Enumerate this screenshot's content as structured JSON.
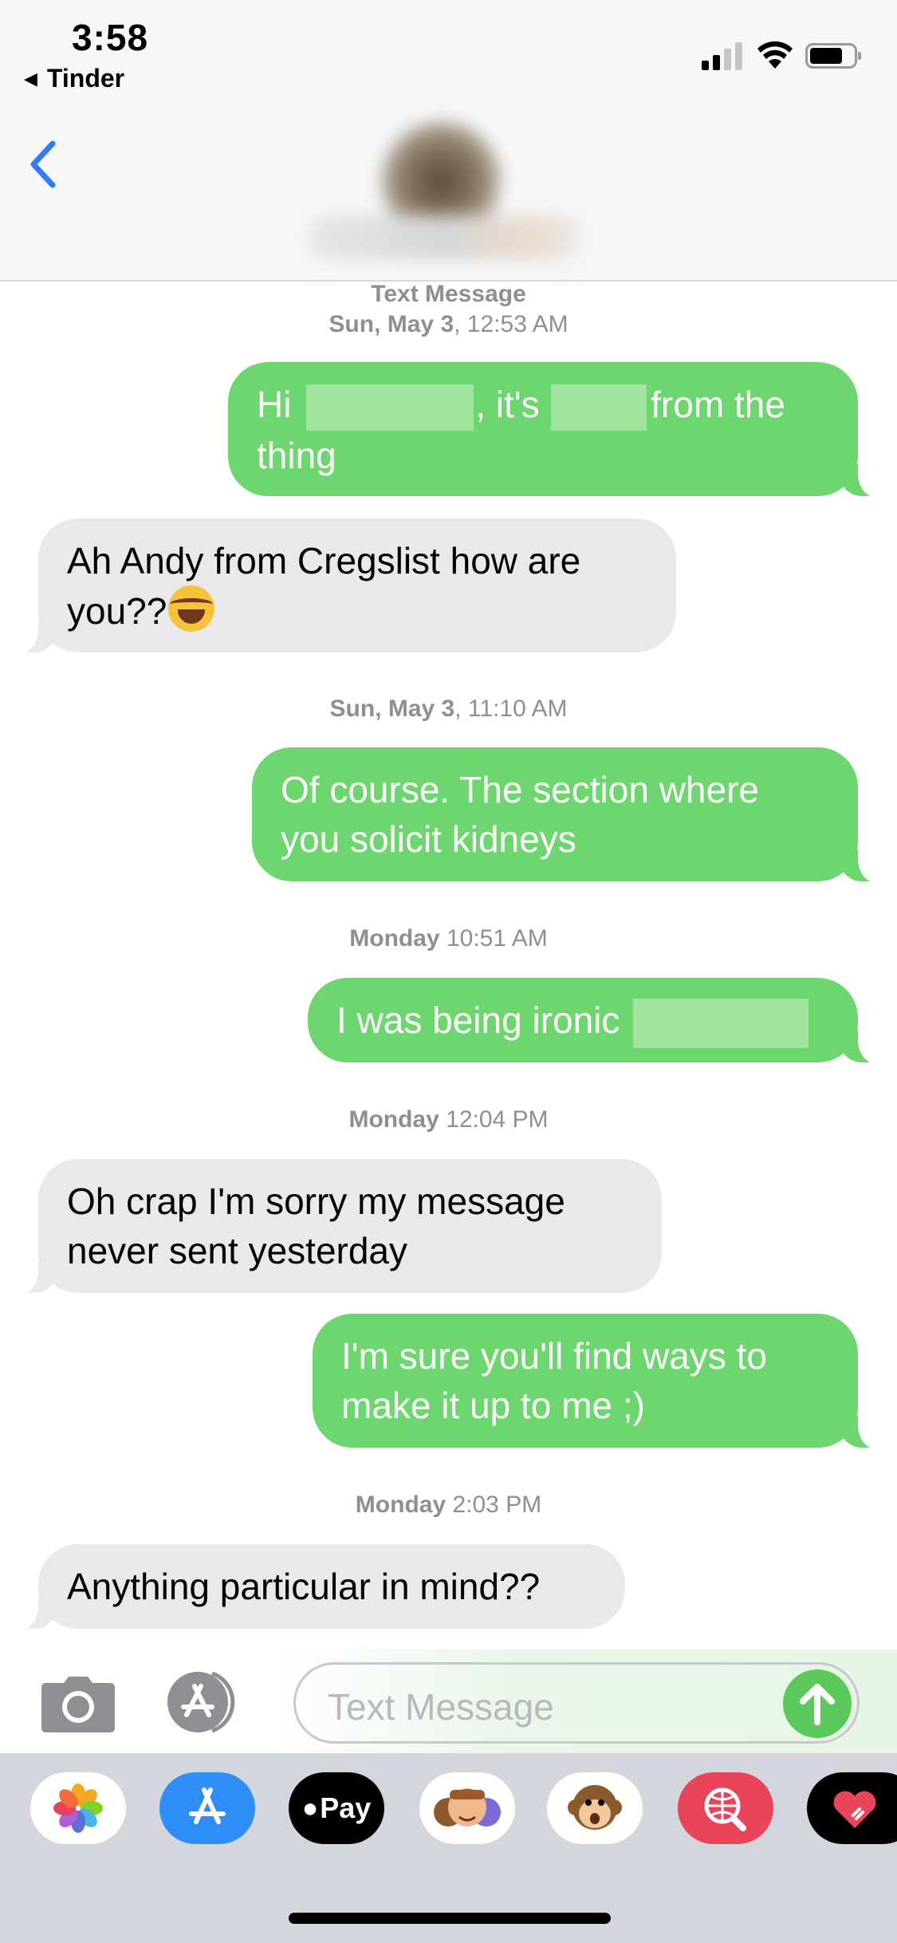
{
  "status_bar": {
    "time": "3:58",
    "back_app": "Tinder"
  },
  "header": {
    "contact": ""
  },
  "messages": [
    {
      "type": "stamp",
      "label": "Text Message",
      "day": "Sun, May 3",
      "time": ", 12:53 AM"
    },
    {
      "type": "sent",
      "parts": [
        "Hi",
        ", it's",
        " from the",
        "thing"
      ]
    },
    {
      "type": "received",
      "text_line1": "Ah Andy from Cregslist how are",
      "text_line2": "you??"
    },
    {
      "type": "stamp",
      "day": "Sun, May 3",
      "time": ", 11:10 AM"
    },
    {
      "type": "sent",
      "line1": "Of course. The section where",
      "line2": "you solicit kidneys"
    },
    {
      "type": "stamp",
      "day": "Monday",
      "time": " 10:51 AM"
    },
    {
      "type": "sent",
      "text": "I was being ironic"
    },
    {
      "type": "stamp",
      "day": "Monday",
      "time": " 12:04 PM"
    },
    {
      "type": "received",
      "line1": "Oh crap I'm sorry my message",
      "line2": "never sent yesterday"
    },
    {
      "type": "sent",
      "line1": "I'm sure you'll find ways to",
      "line2": "make it up to me ;)"
    },
    {
      "type": "stamp",
      "day": "Monday",
      "time": " 2:03 PM"
    },
    {
      "type": "received",
      "text": "Anything particular in mind??"
    }
  ],
  "composer": {
    "placeholder": "Text Message"
  },
  "app_drawer": {
    "apps": [
      "photos-app",
      "app-store-app",
      "apple-pay-app",
      "memoji-app",
      "animoji-app",
      "web-images-app",
      "digital-touch-app"
    ],
    "apple_pay_label": "Pay"
  },
  "colors": {
    "sent_bubble": "#6ed66e",
    "received_bubble": "#e9e9eb",
    "ios_blue": "#2f7cf6",
    "timestamp": "#8e8e93"
  }
}
